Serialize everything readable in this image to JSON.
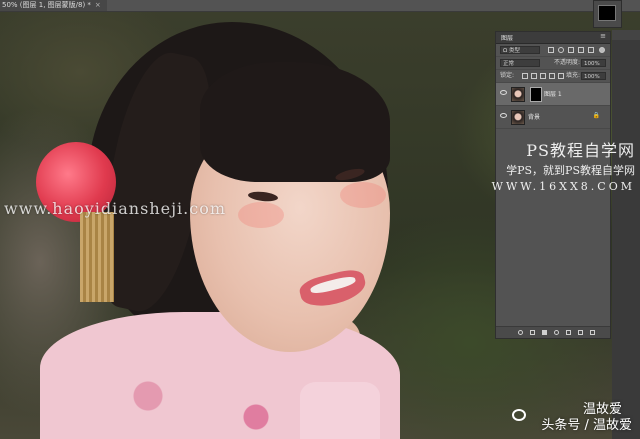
{
  "document_tab": {
    "title": "50% (图层 1, 图层蒙版/8) *",
    "close_glyph": "×"
  },
  "layers_panel": {
    "title": "图层",
    "menu_glyph": "≡",
    "filter_kind": "Ω 类型",
    "blend_mode": "正常",
    "opacity_label": "不透明度:",
    "opacity_value": "100%",
    "lock_label": "锁定:",
    "fill_label": "填充:",
    "fill_value": "100%",
    "layers": [
      {
        "name": "图层 1",
        "selected": true
      },
      {
        "name": "背景",
        "selected": false,
        "locked_glyph": "🔒"
      }
    ]
  },
  "watermarks": {
    "site_left": "www.haoyidiansheji.com",
    "ps_title": "PS教程自学网",
    "ps_sub": "学PS，就到PS教程自学网",
    "ps_url": "WWW.16XX8.COM",
    "author_name": "温故爱",
    "author_line": "头条号 / 温故爱"
  },
  "icons": [
    "close-icon",
    "menu-icon",
    "eye-icon",
    "lock-icon",
    "link-icon",
    "fx-icon",
    "mask-icon",
    "adjustment-icon",
    "folder-icon",
    "new-layer-icon",
    "trash-icon"
  ]
}
